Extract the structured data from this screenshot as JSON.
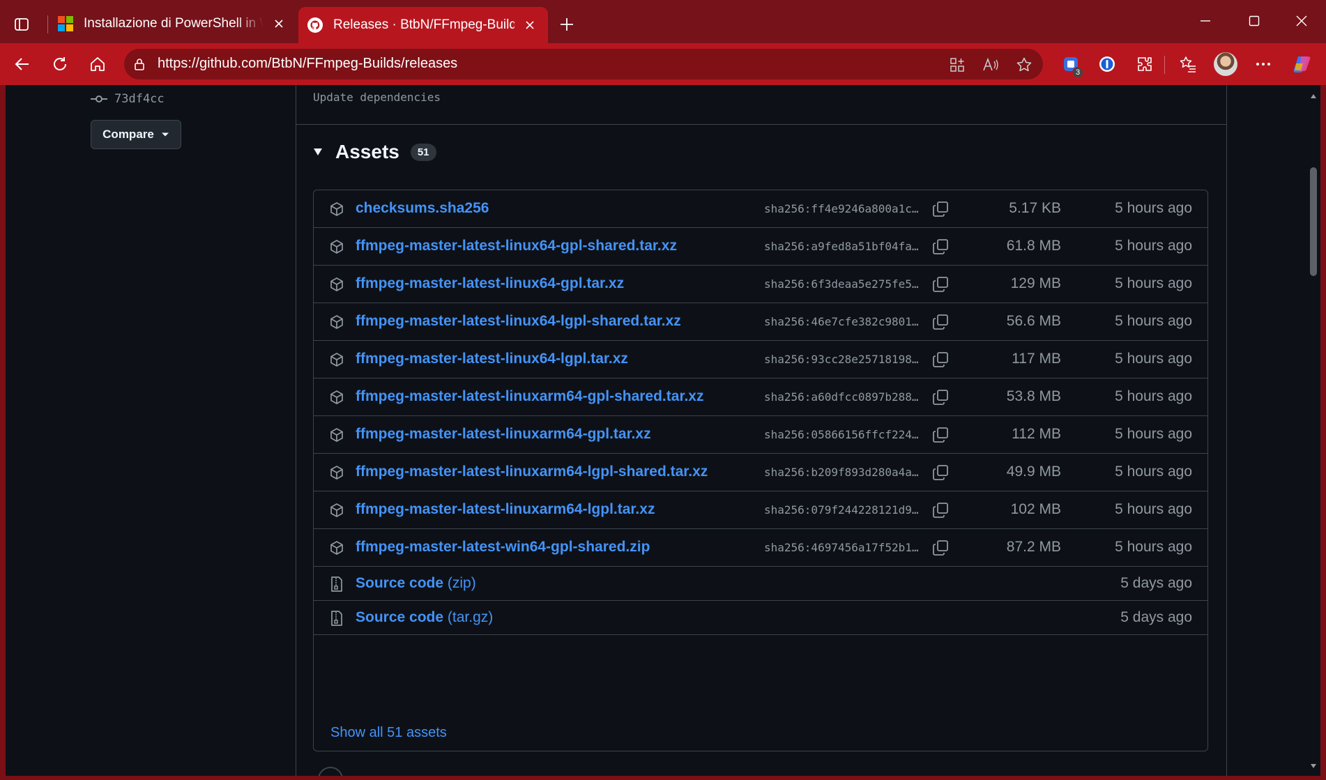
{
  "browser": {
    "tabs": [
      {
        "title": "Installazione di PowerShell in Windows",
        "favicon": "microsoft-logo",
        "active": false
      },
      {
        "title": "Releases · BtbN/FFmpeg-Builds",
        "favicon": "github-icon",
        "active": true
      }
    ],
    "url": "https://github.com/BtbN/FFmpeg-Builds/releases",
    "extension_badge": "3",
    "colors": {
      "frame": "#75121a",
      "toolbar": "#b8161f",
      "page_bg": "#0d1117",
      "link": "#4493f8"
    }
  },
  "sidebar": {
    "commit": "73df4cc",
    "compare_label": "Compare"
  },
  "release": {
    "commit_message": "Update dependencies",
    "assets_title": "Assets",
    "assets_count": "51",
    "assets": [
      {
        "name": "checksums.sha256",
        "sha": "sha256:ff4e9246a800a1c…",
        "size": "5.17 KB",
        "time": "5 hours ago"
      },
      {
        "name": "ffmpeg-master-latest-linux64-gpl-shared.tar.xz",
        "sha": "sha256:a9fed8a51bf04fa…",
        "size": "61.8 MB",
        "time": "5 hours ago"
      },
      {
        "name": "ffmpeg-master-latest-linux64-gpl.tar.xz",
        "sha": "sha256:6f3deaa5e275fe5…",
        "size": "129 MB",
        "time": "5 hours ago"
      },
      {
        "name": "ffmpeg-master-latest-linux64-lgpl-shared.tar.xz",
        "sha": "sha256:46e7cfe382c9801…",
        "size": "56.6 MB",
        "time": "5 hours ago"
      },
      {
        "name": "ffmpeg-master-latest-linux64-lgpl.tar.xz",
        "sha": "sha256:93cc28e25718198…",
        "size": "117 MB",
        "time": "5 hours ago"
      },
      {
        "name": "ffmpeg-master-latest-linuxarm64-gpl-shared.tar.xz",
        "sha": "sha256:a60dfcc0897b288…",
        "size": "53.8 MB",
        "time": "5 hours ago"
      },
      {
        "name": "ffmpeg-master-latest-linuxarm64-gpl.tar.xz",
        "sha": "sha256:05866156ffcf224…",
        "size": "112 MB",
        "time": "5 hours ago"
      },
      {
        "name": "ffmpeg-master-latest-linuxarm64-lgpl-shared.tar.xz",
        "sha": "sha256:b209f893d280a4a…",
        "size": "49.9 MB",
        "time": "5 hours ago"
      },
      {
        "name": "ffmpeg-master-latest-linuxarm64-lgpl.tar.xz",
        "sha": "sha256:079f244228121d9…",
        "size": "102 MB",
        "time": "5 hours ago"
      },
      {
        "name": "ffmpeg-master-latest-win64-gpl-shared.zip",
        "sha": "sha256:4697456a17f52b1…",
        "size": "87.2 MB",
        "time": "5 hours ago"
      }
    ],
    "source": [
      {
        "label": "Source code",
        "format": "(zip)",
        "time": "5 days ago"
      },
      {
        "label": "Source code",
        "format": "(tar.gz)",
        "time": "5 days ago"
      }
    ],
    "show_all": "Show all 51 assets"
  }
}
